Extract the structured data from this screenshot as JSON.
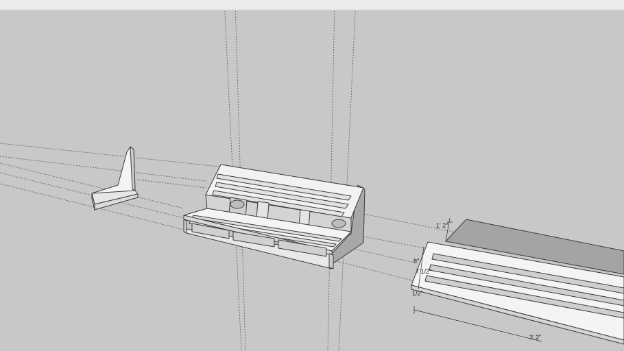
{
  "dimensions": {
    "width_top": "1' 2\"",
    "depth_side": "8\"",
    "offset": "7 1/2\"",
    "thickness": "1/2\"",
    "length_bottom": "3' 2\""
  },
  "colors": {
    "background": "#c8c8c8",
    "face_light": "#f4f4f4",
    "face_mid": "#dadada",
    "face_dark": "#a8a8a8",
    "edge": "#3a3a3a",
    "guide": "#555555"
  }
}
